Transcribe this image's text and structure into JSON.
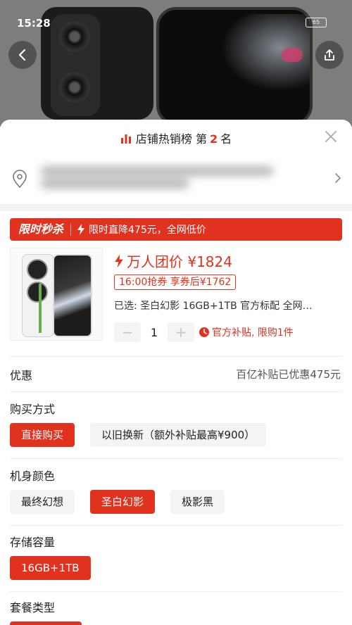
{
  "status_bar": {
    "time": "15:28",
    "battery": "65"
  },
  "sheet": {
    "rank": {
      "prefix": "店铺热销榜 第",
      "number": "2",
      "suffix": "名"
    }
  },
  "flash_sale": {
    "tag": "限时秒杀",
    "desc": "限时直降475元，全网低价"
  },
  "product": {
    "price_label": "万人团价 ¥1824",
    "coupon": "16:00抢券 享券后¥1762",
    "selected": "已选:  圣白幻影 16GB+1TB 官方标配 全网…",
    "quantity": "1",
    "subsidy": "官方补贴, 限购1件"
  },
  "discount": {
    "label": "优惠",
    "value": "百亿补贴已优惠475元"
  },
  "purchase_method": {
    "title": "购买方式",
    "options": [
      "直接购买",
      "以旧换新（额外补贴最高¥900）"
    ],
    "selected_index": 0
  },
  "body_color": {
    "title": "机身颜色",
    "options": [
      "最终幻想",
      "圣白幻影",
      "极影黑"
    ],
    "selected_index": 1
  },
  "storage": {
    "title": "存储容量",
    "options": [
      "16GB+1TB"
    ],
    "selected_index": 0
  },
  "package": {
    "title": "套餐类型"
  },
  "colors": {
    "accent": "#e0321f",
    "chip_bg": "#f4f4f4"
  }
}
